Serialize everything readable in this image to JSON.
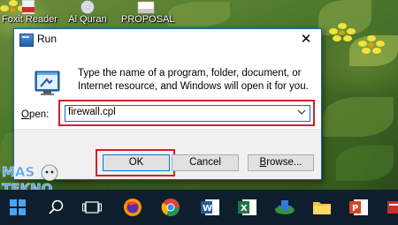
{
  "desktop": {
    "icons": [
      {
        "name": "foxit-reader",
        "label": "Foxit Reader"
      },
      {
        "name": "al-quran",
        "label": "Al Quran"
      },
      {
        "name": "proposal",
        "label": "PROPOSAL"
      }
    ],
    "watermark_text": "MAS TEKNO"
  },
  "dialog": {
    "title": "Run",
    "close_glyph": "✕",
    "description": "Type the name of a program, folder, document, or Internet resource, and Windows will open it for you.",
    "open_label_underlined": "O",
    "open_label_rest": "pen:",
    "input_value": "firewall.cpl",
    "buttons": {
      "ok": "OK",
      "cancel": "Cancel",
      "browse_underlined": "B",
      "browse_rest": "rowse..."
    },
    "highlight_color": "#d0202a"
  },
  "taskbar": {
    "items": [
      "start-icon",
      "search-icon",
      "task-view-icon",
      "firefox-icon",
      "chrome-icon",
      "word-icon",
      "excel-icon",
      "idm-icon",
      "file-explorer-icon",
      "powerpoint-icon",
      "unknown-app-icon"
    ]
  }
}
